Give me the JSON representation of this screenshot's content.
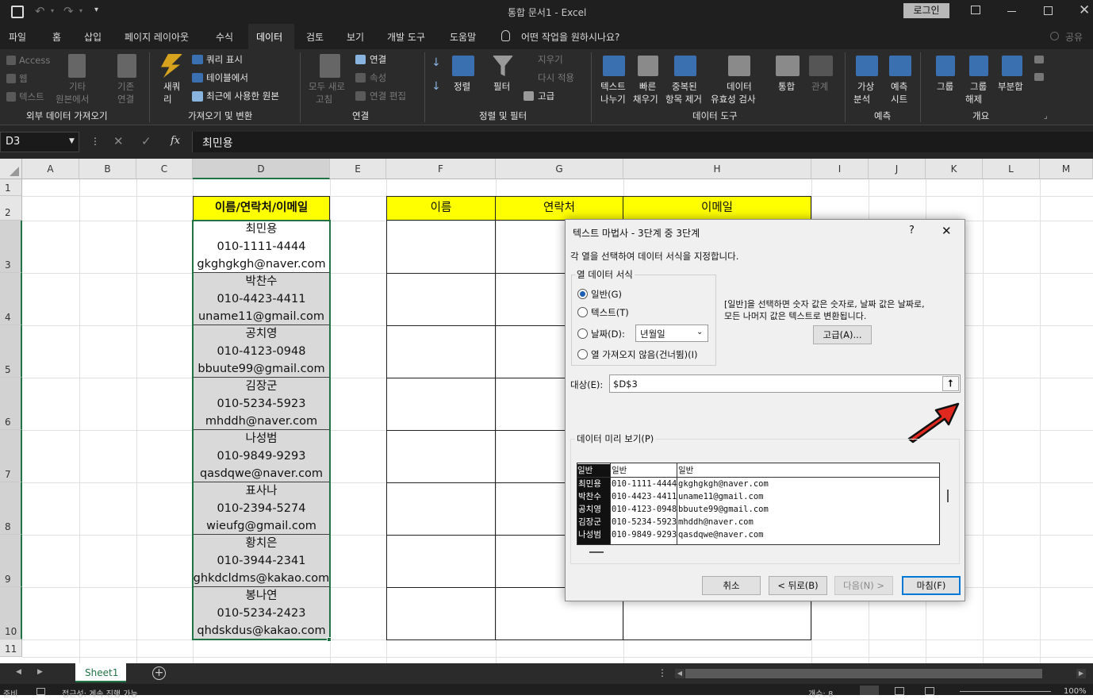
{
  "window": {
    "title": "통합 문서1 - Excel",
    "login": "로그인"
  },
  "tabs": [
    "파일",
    "홈",
    "삽입",
    "페이지 레이아웃",
    "수식",
    "데이터",
    "검토",
    "보기",
    "개발 도구",
    "도움말"
  ],
  "tell_me": "어떤 작업을 원하시나요?",
  "share": "공유",
  "ribbon": {
    "ext": {
      "access": "Access",
      "web": "웹",
      "text": "텍스트",
      "other1": "기타",
      "other2": "원본에서",
      "existing1": "기존",
      "existing2": "연결",
      "label": "외부 데이터 가져오기"
    },
    "get": {
      "new1": "새쿼",
      "new2": "리",
      "show_query": "쿼리 표시",
      "from_table": "테이블에서",
      "recent": "최근에 사용한 원본",
      "label": "가져오기 및 변환"
    },
    "conn": {
      "refresh1": "모두 새로",
      "refresh2": "고침",
      "connections": "연결",
      "properties": "속성",
      "edit_links": "연결 편집",
      "label": "연결"
    },
    "sort": {
      "sort": "정렬",
      "filter": "필터",
      "clear": "지우기",
      "reapply": "다시 적용",
      "advanced": "고급",
      "label": "정렬 및 필터"
    },
    "tools": {
      "t2c1": "텍스트",
      "t2c2": "나누기",
      "flash1": "빠른",
      "flash2": "채우기",
      "dup1": "중복된",
      "dup2": "항목 제거",
      "val1": "데이터",
      "val2": "유효성 검사",
      "consolidate": "통합",
      "relations": "관계",
      "label": "데이터 도구"
    },
    "forecast": {
      "whatif1": "가상",
      "whatif2": "분석",
      "sheet1": "예측",
      "sheet2": "시트",
      "label": "예측"
    },
    "outline": {
      "group": "그룹",
      "ungroup1": "그룹",
      "ungroup2": "해제",
      "subtotal": "부분합",
      "label": "개요"
    }
  },
  "formula_bar": {
    "name_box": "D3",
    "value": "최민용"
  },
  "columns": [
    "A",
    "B",
    "C",
    "D",
    "E",
    "F",
    "G",
    "H",
    "I",
    "J",
    "K",
    "L",
    "M"
  ],
  "rows": [
    "1",
    "2",
    "3",
    "4",
    "5",
    "6",
    "7",
    "8",
    "9",
    "10",
    "11"
  ],
  "cells": {
    "d2": "이름/연락처/이메일",
    "f2": "이름",
    "g2": "연락처",
    "h2": "이메일"
  },
  "entries": [
    {
      "name": "최민용",
      "phone": "010-1111-4444",
      "email": "gkghgkgh@naver.com"
    },
    {
      "name": "박찬수",
      "phone": "010-4423-4411",
      "email": "uname11@gmail.com"
    },
    {
      "name": "공치영",
      "phone": "010-4123-0948",
      "email": "bbuute99@gmail.com"
    },
    {
      "name": "김장군",
      "phone": "010-5234-5923",
      "email": "mhddh@naver.com"
    },
    {
      "name": "나성범",
      "phone": "010-9849-9293",
      "email": "qasdqwe@naver.com"
    },
    {
      "name": "표사나",
      "phone": "010-2394-5274",
      "email": "wieufg@gmail.com"
    },
    {
      "name": "황치은",
      "phone": "010-3944-2341",
      "email": "ghkdcldms@kakao.com"
    },
    {
      "name": "봉나연",
      "phone": "010-5234-2423",
      "email": "qhdskdus@kakao.com"
    }
  ],
  "sheet_tab": "Sheet1",
  "status": {
    "ready": "준비",
    "accessibility": "접근성: 계속 진행 가능",
    "count": "개수: 8",
    "zoom": "100%"
  },
  "dialog": {
    "title": "텍스트 마법사 - 3단계 중 3단계",
    "help": "?",
    "instruction": "각 열을 선택하여 데이터 서식을 지정합니다.",
    "group_title": "열 데이터 서식",
    "opt_general": "일반(G)",
    "opt_text": "텍스트(T)",
    "opt_date": "날짜(D):",
    "date_format": "년월일",
    "opt_skip": "열 가져오지 않음(건너뜀)(I)",
    "desc1": "[일반]을 선택하면 숫자 값은 숫자로, 날짜 값은 날짜로,",
    "desc2": "모든 나머지 값은 텍스트로 변환됩니다.",
    "advanced_btn": "고급(A)...",
    "dest_label": "대상(E):",
    "dest_value": "$D$3",
    "preview_label": "데이터 미리 보기(P)",
    "preview_headers": [
      "일반",
      "일반",
      "일반"
    ],
    "preview_rows": [
      [
        "최민용",
        "010-1111-4444",
        "gkghgkgh@naver.com"
      ],
      [
        "박찬수",
        "010-4423-4411",
        "uname11@gmail.com"
      ],
      [
        "공치영",
        "010-4123-0948",
        "bbuute99@gmail.com"
      ],
      [
        "김장군",
        "010-5234-5923",
        "mhddh@naver.com"
      ],
      [
        "나성범",
        "010-9849-9293",
        "qasdqwe@naver.com"
      ]
    ],
    "cancel": "취소",
    "back": "< 뒤로(B)",
    "next": "다음(N) >",
    "finish": "마침(F)"
  }
}
